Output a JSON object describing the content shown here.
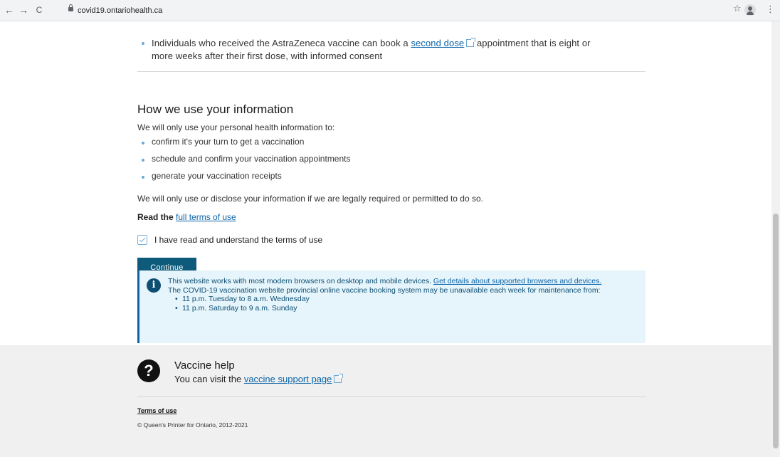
{
  "browser": {
    "url": "covid19.ontariohealth.ca",
    "back_label": "←",
    "forward_label": "→",
    "reload_label": "C",
    "star_label": "☆",
    "menu_label": "⋮"
  },
  "eligibility": {
    "astra_text_before": "Individuals who received the AstraZeneca vaccine can book a ",
    "astra_link": "second dose",
    "astra_text_after": " appointment that is eight or more weeks after their first dose, with informed consent"
  },
  "info_use": {
    "heading": "How we use your information",
    "intro": "We will only use your personal health information to:",
    "items": [
      "confirm it's your turn to get a vaccination",
      "schedule and confirm your vaccination appointments",
      "generate your vaccination receipts"
    ],
    "disclose": "We will only use or disclose your information if we are legally required or permitted to do so.",
    "read_prefix": "Read the",
    "read_link": "full terms of use"
  },
  "consent": {
    "checkbox_label": "I have read and understand the terms of use",
    "continue_label": "Continue"
  },
  "notice": {
    "line1_before": "This website works with most modern browsers on desktop and mobile devices. ",
    "line1_link": "Get details about supported browsers and devices.",
    "line2": "The COVID-19 vaccination website provincial online vaccine booking system may be unavailable each week for maintenance from:",
    "items": [
      "11 p.m. Tuesday to 8 a.m. Wednesday",
      "11 p.m. Saturday to 9 a.m. Sunday"
    ]
  },
  "footer": {
    "help_title": "Vaccine help",
    "help_text_before": "You can visit the ",
    "help_link": "vaccine support page",
    "terms_link": "Terms of use",
    "copyright": "© Queen's Printer for Ontario, 2012-2021"
  },
  "icons": {
    "info": "info-icon",
    "help": "help-icon",
    "external": "external-link-icon"
  }
}
